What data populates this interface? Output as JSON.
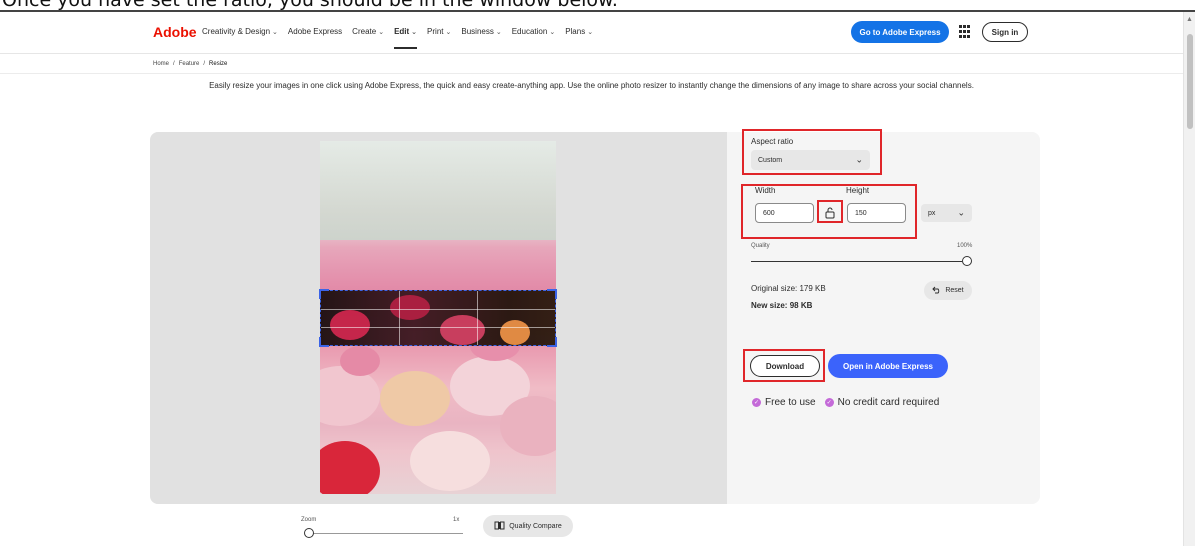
{
  "caption": "Once you have set the ratio, you should be in the window below.",
  "header": {
    "logo": "Adobe",
    "nav": [
      {
        "label": "Creativity & Design",
        "chevron": true,
        "active": false
      },
      {
        "label": "Adobe Express",
        "chevron": false,
        "active": false
      },
      {
        "label": "Create",
        "chevron": true,
        "active": false
      },
      {
        "label": "Edit",
        "chevron": true,
        "active": true
      },
      {
        "label": "Print",
        "chevron": true,
        "active": false
      },
      {
        "label": "Business",
        "chevron": true,
        "active": false
      },
      {
        "label": "Education",
        "chevron": true,
        "active": false
      },
      {
        "label": "Plans",
        "chevron": true,
        "active": false
      }
    ],
    "cta": "Go to Adobe Express",
    "signin": "Sign in"
  },
  "breadcrumb": {
    "home": "Home",
    "sep": "/",
    "feature": "Feature",
    "current": "Resize"
  },
  "intro": "Easily resize your images in one click using Adobe Express, the quick and easy create-anything app. Use the online photo resizer to instantly change the dimensions of any image to share across your social channels.",
  "zoom": {
    "label": "Zoom",
    "value": "1x"
  },
  "quality_compare": "Quality Compare",
  "aspect_ratio": {
    "label": "Aspect ratio",
    "value": "Custom"
  },
  "dimensions": {
    "width_label": "Width",
    "height_label": "Height",
    "width": "600",
    "height": "150",
    "unit": "px"
  },
  "quality": {
    "label": "Quality",
    "value": "100%",
    "level": 1.0
  },
  "sizes": {
    "original_label": "Original size:",
    "original": "179 KB",
    "new_label": "New size:",
    "new": "98 KB"
  },
  "reset": "Reset",
  "download": "Download",
  "open_in": "Open in Adobe Express",
  "features": [
    "Free to use",
    "No credit card required"
  ],
  "colors": {
    "accent": "#3b63fb",
    "cta": "#1473e6",
    "highlight": "#e0262a",
    "logo": "#eb1000",
    "check": "#c46ad8"
  }
}
